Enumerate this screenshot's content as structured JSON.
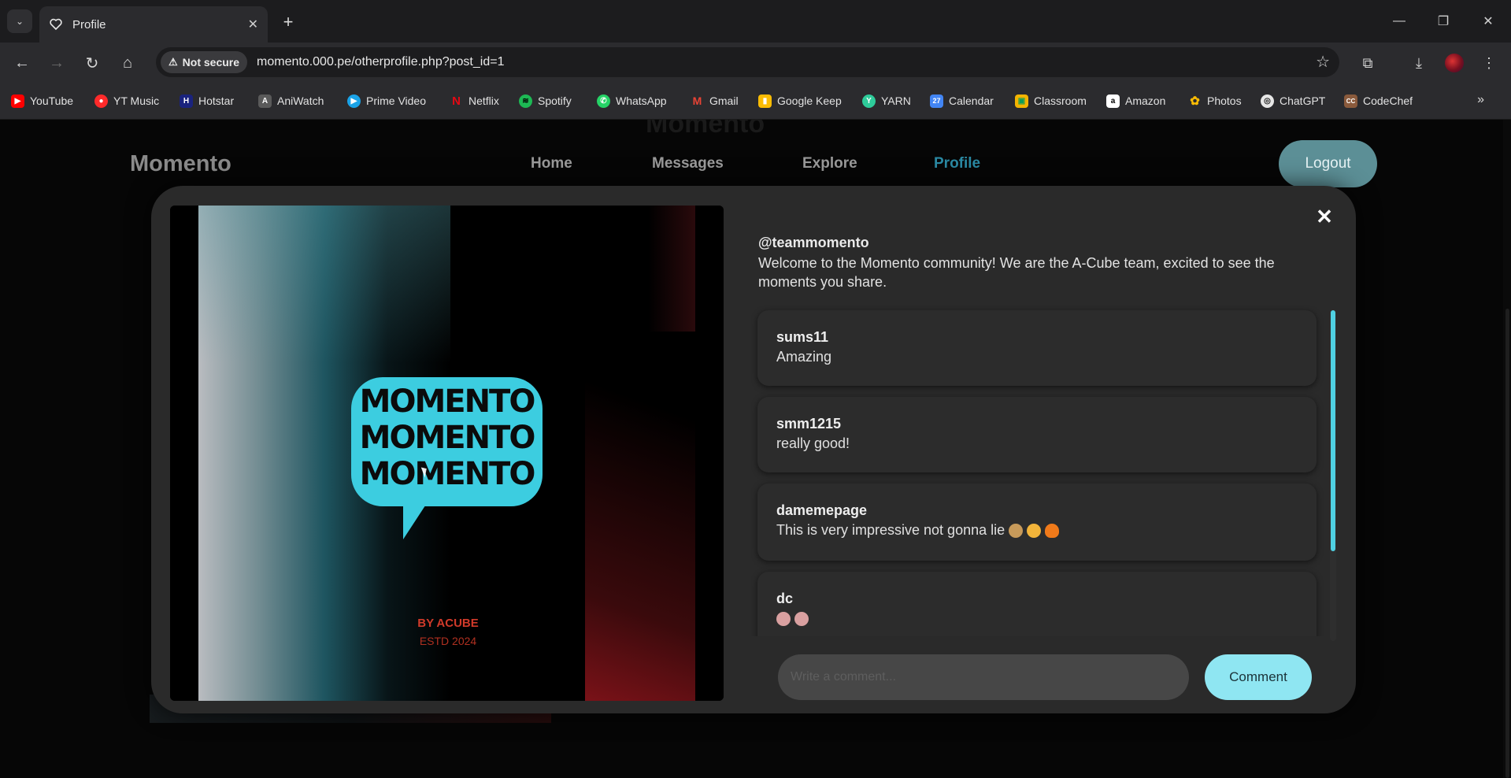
{
  "browser": {
    "tab_title": "Profile",
    "security_label": "Not secure",
    "url": "momento.000.pe/otherprofile.php?post_id=1",
    "bookmarks": [
      {
        "label": "YouTube",
        "color": "#ff0000",
        "glyph": "▶"
      },
      {
        "label": "YT Music",
        "color": "#ff2a2a",
        "glyph": "●"
      },
      {
        "label": "Hotstar",
        "color": "#1a237e",
        "glyph": "H"
      },
      {
        "label": "AniWatch",
        "color": "#6a6a6a",
        "glyph": "A"
      },
      {
        "label": "Prime Video",
        "color": "#1aa3e8",
        "glyph": "▶"
      },
      {
        "label": "Netflix",
        "color": "#e50914",
        "glyph": "N"
      },
      {
        "label": "Spotify",
        "color": "#1db954",
        "glyph": "≋"
      },
      {
        "label": "WhatsApp",
        "color": "#25d366",
        "glyph": "✆"
      },
      {
        "label": "Gmail",
        "color": "#ea4335",
        "glyph": "M"
      },
      {
        "label": "Google Keep",
        "color": "#fbbc04",
        "glyph": "▮"
      },
      {
        "label": "YARN",
        "color": "#2ecc9a",
        "glyph": "Y"
      },
      {
        "label": "Calendar",
        "color": "#4285f4",
        "glyph": "27"
      },
      {
        "label": "Classroom",
        "color": "#f4b400",
        "glyph": "▣"
      },
      {
        "label": "Amazon",
        "color": "#ffffff",
        "glyph": "a"
      },
      {
        "label": "Photos",
        "color": "#34a853",
        "glyph": "✿"
      },
      {
        "label": "ChatGPT",
        "color": "#e6e6e6",
        "glyph": "◎"
      },
      {
        "label": "CodeChef",
        "color": "#8a5a3c",
        "glyph": "CC"
      }
    ]
  },
  "site": {
    "brand": "Momento",
    "nav": {
      "home": "Home",
      "messages": "Messages",
      "explore": "Explore",
      "profile": "Profile"
    },
    "logout_label": "Logout",
    "accent": "#2b8aa4"
  },
  "modal": {
    "image": {
      "speech_lines": [
        "MOMENTO",
        "MOMENTO",
        "MOMENTO"
      ],
      "byline": "BY ACUBE",
      "estd": "ESTD 2024",
      "bubble_color": "#3ccde0"
    },
    "close_glyph": "✕",
    "caption": {
      "user": "@teammomento",
      "text": "Welcome to the Momento community! We are the A-Cube team, excited to see the moments you share."
    },
    "comments": [
      {
        "user": "sums11",
        "text": "Amazing"
      },
      {
        "user": "smm1215",
        "text": "really good!"
      },
      {
        "user": "damemepage",
        "text": "This is very impressive not gonna lie"
      },
      {
        "user": "dc",
        "text": ""
      }
    ],
    "comment_placeholder": "Write a comment...",
    "comment_button": "Comment"
  }
}
